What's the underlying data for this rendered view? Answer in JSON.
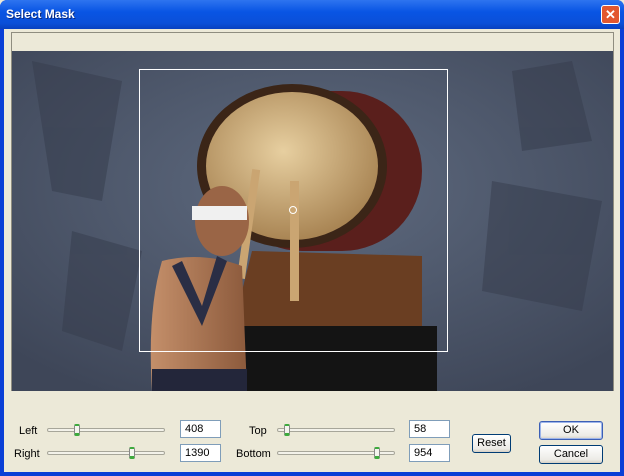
{
  "window": {
    "title": "Select Mask",
    "close_icon": "close-icon"
  },
  "controls": {
    "left": {
      "label": "Left",
      "value": "408",
      "slider_fraction": 0.24
    },
    "right": {
      "label": "Right",
      "value": "1390",
      "slider_fraction": 0.73
    },
    "top": {
      "label": "Top",
      "value": "58",
      "slider_fraction": 0.06
    },
    "bottom": {
      "label": "Bottom",
      "value": "954",
      "slider_fraction": 0.87
    }
  },
  "buttons": {
    "reset": "Reset",
    "ok": "OK",
    "cancel": "Cancel"
  }
}
